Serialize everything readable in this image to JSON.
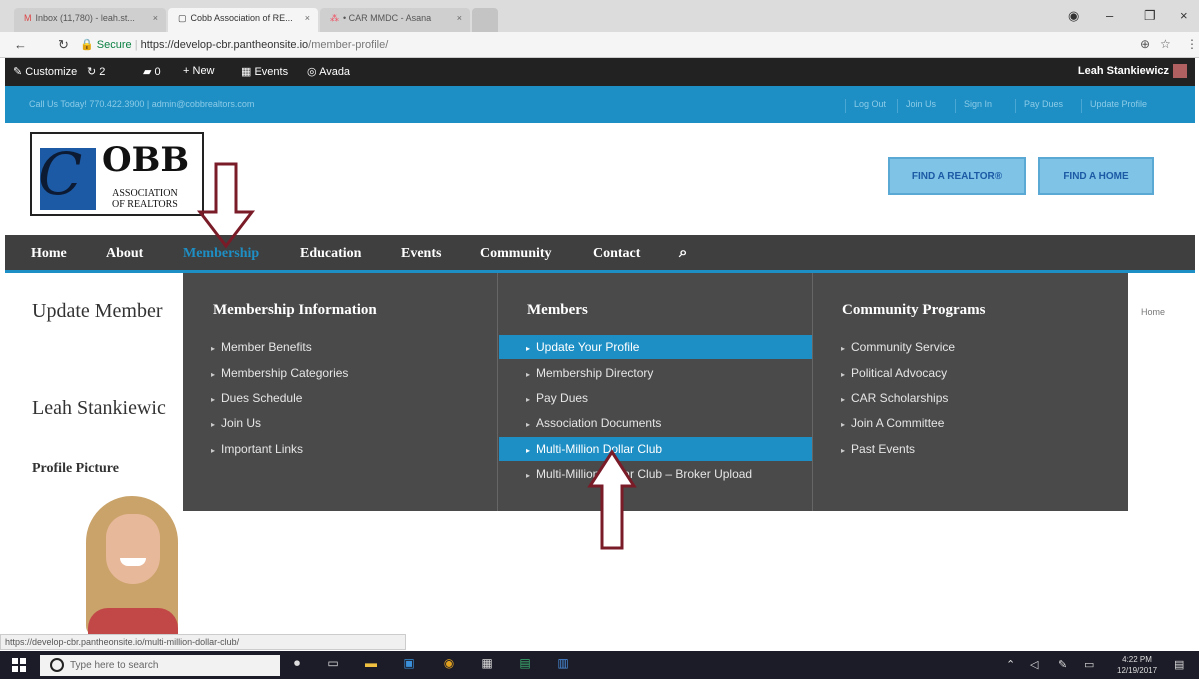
{
  "browser": {
    "tabs": [
      {
        "icon": "M",
        "title": "Inbox (11,780) - leah.st..."
      },
      {
        "icon": "▢",
        "title": "Cobb Association of RE..."
      },
      {
        "icon": "⁂",
        "title": "• CAR MMDC - Asana"
      }
    ],
    "close_glyph": "×",
    "url_secure_label": "Secure",
    "url_host": "https://develop-cbr.pantheonsite.io",
    "url_path": "/member-profile/",
    "status_url": "https://develop-cbr.pantheonsite.io/multi-million-dollar-club/"
  },
  "adminbar": {
    "items": [
      "Customize",
      "2",
      "0",
      "New",
      "Events",
      "Avada"
    ],
    "user": "Leah Stankiewicz"
  },
  "infobar": {
    "contact": "Call Us Today! 770.422.3900 | admin@cobbrealtors.com",
    "links": [
      "Log Out",
      "Join Us",
      "Sign In",
      "Pay Dues",
      "Update Profile"
    ]
  },
  "header": {
    "logo_c": "C",
    "logo_obb": "OBB",
    "logo_assoc": "ASSOCIATION\nOF REALTORS",
    "buttons": [
      "FIND A REALTOR®",
      "FIND A HOME"
    ]
  },
  "nav": {
    "items": [
      "Home",
      "About",
      "Membership",
      "Education",
      "Events",
      "Community",
      "Contact"
    ]
  },
  "page": {
    "title": "Update Member",
    "breadcrumb": "Home",
    "name": "Leah Stankiewic",
    "profile_picture_label": "Profile Picture"
  },
  "mega": {
    "columns": [
      {
        "heading": "Membership Information",
        "items": [
          "Member Benefits",
          "Membership Categories",
          "Dues Schedule",
          "Join Us",
          "Important Links"
        ]
      },
      {
        "heading": "Members",
        "items": [
          "Update Your Profile",
          "Membership Directory",
          "Pay Dues",
          "Association Documents",
          "Multi-Million Dollar Club",
          "Multi-Million Dollar Club – Broker Upload"
        ]
      },
      {
        "heading": "Community Programs",
        "items": [
          "Community Service",
          "Political Advocacy",
          "CAR Scholarships",
          "Join A Committee",
          "Past Events"
        ]
      }
    ]
  },
  "taskbar": {
    "search_placeholder": "Type here to search",
    "time": "4:22 PM",
    "date": "12/19/2017"
  },
  "colors": {
    "accent": "#1e8fc4",
    "nav_bg": "#3f3f3f",
    "menu_bg": "#4a4a4a",
    "arrow": "#7a1b28"
  }
}
